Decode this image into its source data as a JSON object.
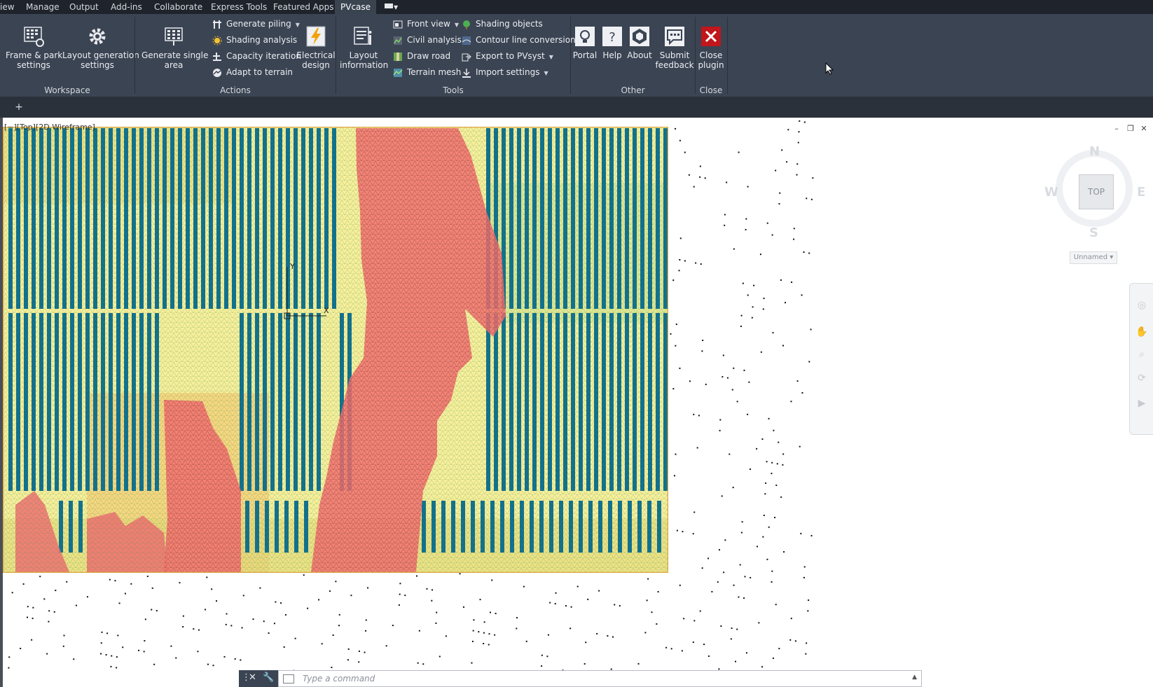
{
  "menu": {
    "tabs": [
      "iew",
      "Manage",
      "Output",
      "Add-ins",
      "Collaborate",
      "Express Tools",
      "Featured Apps",
      "PVcase"
    ],
    "active_tab": "PVcase"
  },
  "ribbon": {
    "workspace": {
      "label": "Workspace",
      "frame_park": "Frame & park settings",
      "frame_park_l1": "Frame & park",
      "frame_park_l2": "settings",
      "layout_gen_l1": "Layout generation",
      "layout_gen_l2": "settings"
    },
    "actions": {
      "label": "Actions",
      "gen_single_l1": "Generate single",
      "gen_single_l2": "area",
      "generate_piling": "Generate piling",
      "shading_analysis": "Shading analysis",
      "capacity_iteration": "Capacity iteration",
      "adapt_to_terrain": "Adapt to terrain",
      "electrical_l1": "Electrical",
      "electrical_l2": "design"
    },
    "tools": {
      "label": "Tools",
      "layout_info_l1": "Layout",
      "layout_info_l2": "information",
      "front_view": "Front view",
      "civil_analysis": "Civil analysis",
      "draw_road": "Draw road",
      "terrain_mesh": "Terrain mesh",
      "shading_objects": "Shading objects",
      "contour_line_conversion": "Contour line conversion",
      "export_pvsyst": "Export to PVsyst",
      "import_settings": "Import settings"
    },
    "other": {
      "label": "Other",
      "portal": "Portal",
      "help": "Help",
      "about": "About",
      "submit_l1": "Submit",
      "submit_l2": "feedback"
    },
    "close": {
      "label": "Close",
      "close_l1": "Close",
      "close_l2": "plugin"
    }
  },
  "viewport": {
    "label": "[−][Top][2D Wireframe]",
    "axis_y": "Y",
    "axis_x": "X"
  },
  "viewcube": {
    "n": "N",
    "s": "S",
    "e": "E",
    "w": "W",
    "top": "TOP",
    "ucs": "Unnamed"
  },
  "command": {
    "placeholder": "Type a command"
  },
  "colors": {
    "ribbon_bg": "#3b4453",
    "menubar_bg": "#1f242c",
    "panel_rows": "#0f6f8f",
    "shading_red": "#f07070",
    "terrain_yellow": "#f6f09a",
    "close_red": "#c0161c"
  }
}
